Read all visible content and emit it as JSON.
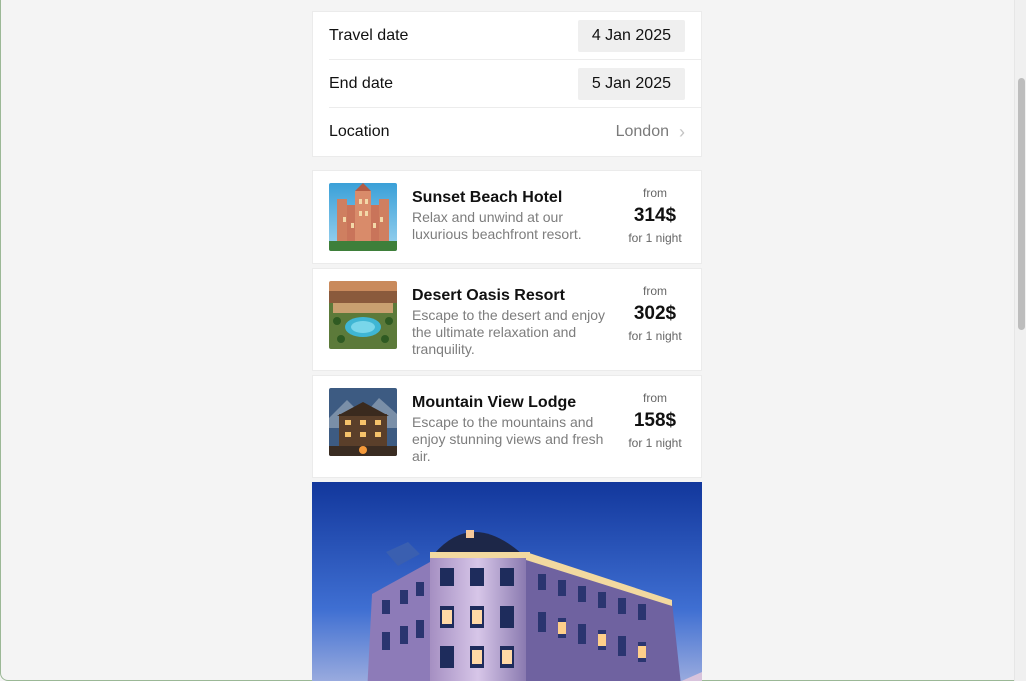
{
  "form": {
    "travel_date_label": "Travel date",
    "travel_date_value": "4 Jan 2025",
    "end_date_label": "End date",
    "end_date_value": "5 Jan 2025",
    "location_label": "Location",
    "location_value": "London"
  },
  "hotels": [
    {
      "name": "Sunset Beach Hotel",
      "description": "Relax and unwind at our luxurious beachfront resort.",
      "from": "from",
      "price": "314$",
      "nights": "for 1 night"
    },
    {
      "name": "Desert Oasis Resort",
      "description": "Escape to the desert and enjoy the ultimate relaxation and tranquility.",
      "from": "from",
      "price": "302$",
      "nights": "for 1 night"
    },
    {
      "name": "Mountain View Lodge",
      "description": "Escape to the mountains and enjoy stunning views and fresh air.",
      "from": "from",
      "price": "158$",
      "nights": "for 1 night"
    }
  ],
  "icons": {
    "location_chevron": "chevron-right-icon"
  }
}
